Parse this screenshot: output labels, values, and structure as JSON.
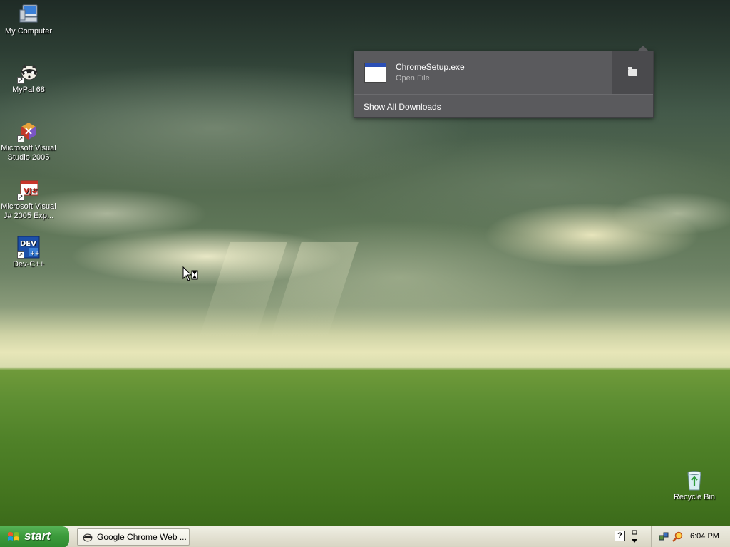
{
  "desktop": {
    "icons": [
      {
        "label": "My Computer"
      },
      {
        "label": "MyPal 68"
      },
      {
        "label": "Microsoft Visual Studio 2005"
      },
      {
        "label": "Microsoft Visual J# 2005 Exp..."
      },
      {
        "label": "Dev-C++"
      },
      {
        "label": "Recycle Bin"
      }
    ]
  },
  "download_bubble": {
    "file_name": "ChromeSetup.exe",
    "status": "Open File",
    "show_all_label": "Show All Downloads"
  },
  "taskbar": {
    "start_label": "start",
    "tasks": [
      {
        "label": "Google Chrome Web ...",
        "icon": "mypal-icon"
      }
    ],
    "help_glyph": "?",
    "clock": "6:04 PM"
  },
  "colors": {
    "start_green": "#3c9b3c",
    "bubble_bg": "#5a5a5d",
    "xp_blue": "#2b4fb5"
  }
}
